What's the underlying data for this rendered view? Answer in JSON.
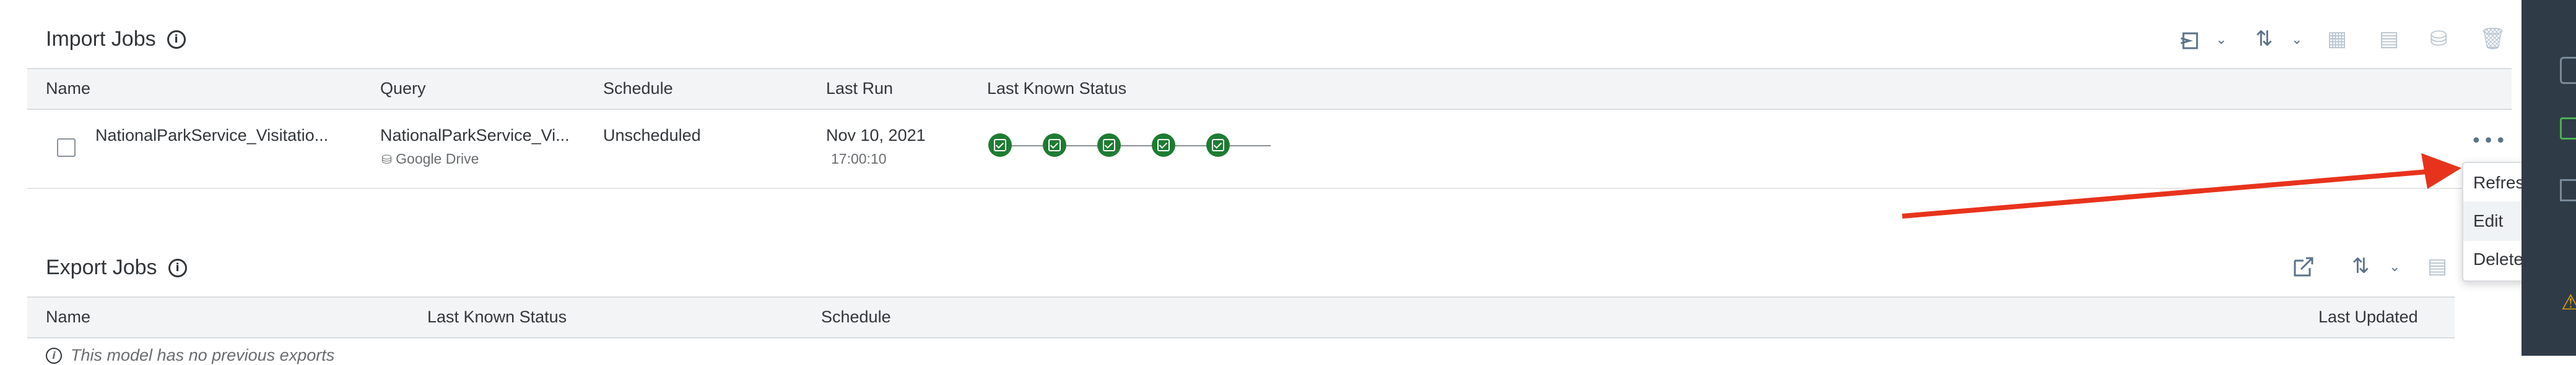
{
  "import_section": {
    "title": "Import Jobs",
    "info_icon": "info-icon",
    "columns": [
      "Name",
      "Query",
      "Schedule",
      "Last Run",
      "Last Known Status"
    ],
    "row": {
      "name": "NationalParkService_Visitatio...",
      "query": "NationalParkService_Vi...",
      "query_source": "Google Drive",
      "schedule": "Unscheduled",
      "last_run_date": "Nov 10, 2021",
      "last_run_time": "17:00:10",
      "status_steps": 5,
      "status_color": "#1e7c32"
    },
    "toolbar_icons": [
      "import-icon",
      "chevron-down-icon",
      "sort-icon",
      "chevron-down-icon",
      "table-settings-icon",
      "calendar-icon",
      "database-icon",
      "trash-icon"
    ]
  },
  "context_menu": {
    "items": [
      "Refresh",
      "Edit",
      "Delete"
    ],
    "hovered": "Edit"
  },
  "export_section": {
    "title": "Export Jobs",
    "columns": [
      "Name",
      "Last Known Status",
      "Schedule",
      "Last Updated"
    ],
    "empty_message": "This model has no previous exports",
    "toolbar_icons": [
      "export-icon",
      "sort-icon",
      "chevron-down-icon",
      "calendar-icon"
    ]
  },
  "annotation": {
    "arrow_color": "#e8331c"
  },
  "colors": {
    "accent": "#5b738b",
    "header_bg": "#f3f4f5",
    "sidebar_bg": "#2f3c48",
    "status_green": "#1e7c32"
  }
}
